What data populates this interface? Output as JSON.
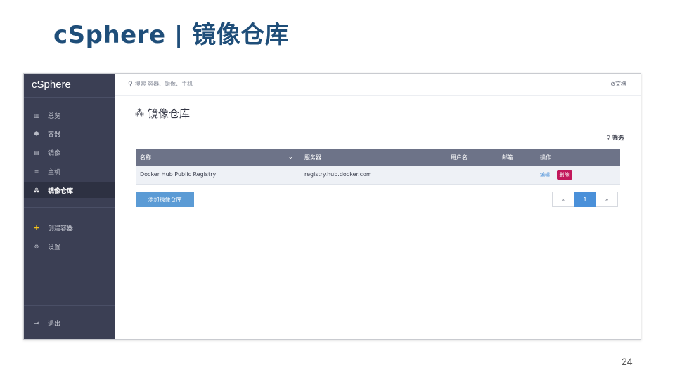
{
  "slide": {
    "title": "cSphere | 镜像仓库",
    "page_number": "24"
  },
  "app": {
    "brand": "cSphere",
    "search_placeholder": "搜索 容器、镜像、主机",
    "docs_label": "文档",
    "sidebar": {
      "items": [
        {
          "label": "总览",
          "icon": "chart-icon"
        },
        {
          "label": "容器",
          "icon": "container-icon"
        },
        {
          "label": "镜像",
          "icon": "image-icon"
        },
        {
          "label": "主机",
          "icon": "host-icon"
        },
        {
          "label": "镜像仓库",
          "icon": "registry-icon",
          "active": true
        },
        {
          "label": "创建容器",
          "icon": "plus-icon"
        },
        {
          "label": "设置",
          "icon": "settings-icon"
        },
        {
          "label": "退出",
          "icon": "logout-icon"
        }
      ]
    },
    "page_heading": "镜像仓库",
    "filter_label": "筛选",
    "table": {
      "columns": [
        "名称",
        "服务器",
        "用户名",
        "邮箱",
        "操作"
      ],
      "rows": [
        {
          "name": "Docker Hub Public Registry",
          "server": "registry.hub.docker.com",
          "username": "",
          "email": "",
          "edit": "编辑",
          "delete": "删除"
        }
      ]
    },
    "add_button": "添加镜像仓库",
    "pagination": {
      "prev": "«",
      "current": "1",
      "next": "»"
    },
    "colors": {
      "sidebar_bg": "#3b3f54",
      "table_header_bg": "#6d7388",
      "accent_blue": "#5b9bd5",
      "delete_red": "#c2185b",
      "title_blue": "#1f4e79"
    }
  }
}
